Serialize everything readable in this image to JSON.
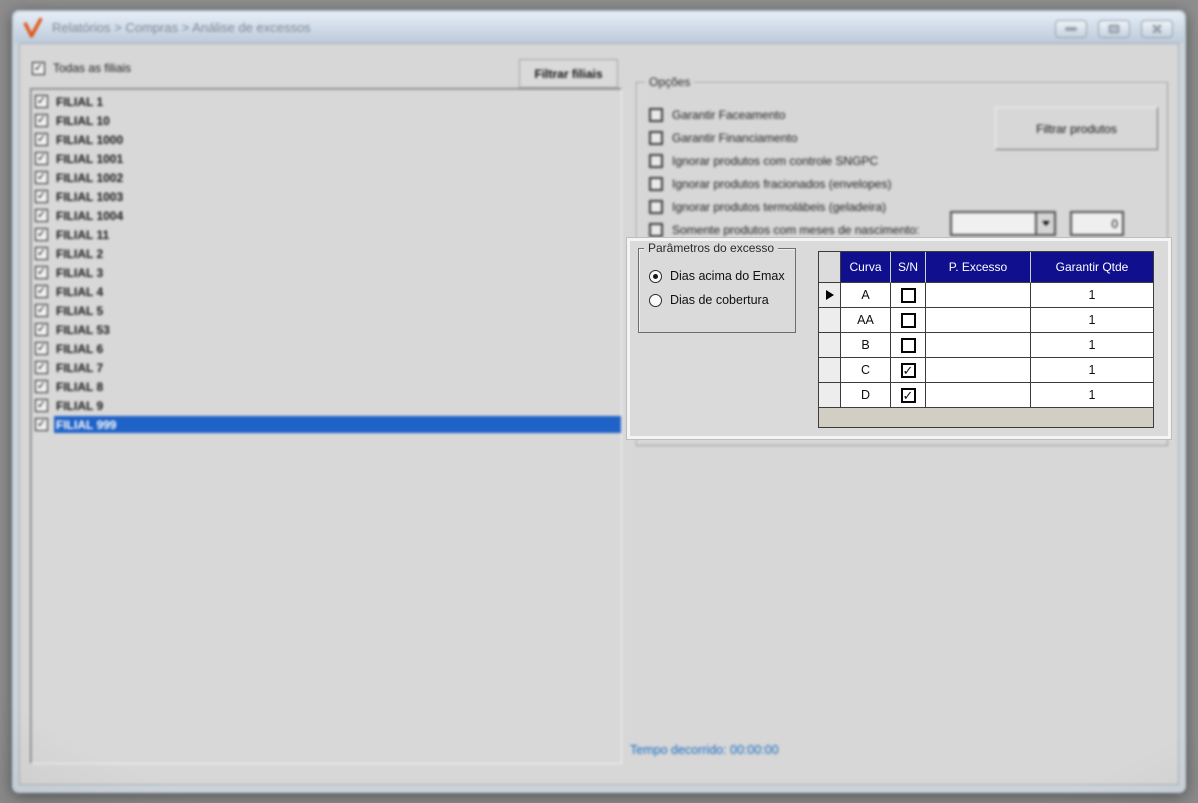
{
  "window": {
    "title": "Relatórios > Compras > Análise de excessos",
    "logo_icon": "v-check-logo"
  },
  "branches": {
    "select_all": {
      "label": "Todas as filiais",
      "checked": true
    },
    "filter_button_label": "Filtrar filiais",
    "items": [
      {
        "label": "FILIAL 1",
        "checked": true,
        "selected": false
      },
      {
        "label": "FILIAL 10",
        "checked": true,
        "selected": false
      },
      {
        "label": "FILIAL 1000",
        "checked": true,
        "selected": false
      },
      {
        "label": "FILIAL 1001",
        "checked": true,
        "selected": false
      },
      {
        "label": "FILIAL 1002",
        "checked": true,
        "selected": false
      },
      {
        "label": "FILIAL 1003",
        "checked": true,
        "selected": false
      },
      {
        "label": "FILIAL 1004",
        "checked": true,
        "selected": false
      },
      {
        "label": "FILIAL 11",
        "checked": true,
        "selected": false
      },
      {
        "label": "FILIAL 2",
        "checked": true,
        "selected": false
      },
      {
        "label": "FILIAL 3",
        "checked": true,
        "selected": false
      },
      {
        "label": "FILIAL 4",
        "checked": true,
        "selected": false
      },
      {
        "label": "FILIAL 5",
        "checked": true,
        "selected": false
      },
      {
        "label": "FILIAL 53",
        "checked": true,
        "selected": false
      },
      {
        "label": "FILIAL 6",
        "checked": true,
        "selected": false
      },
      {
        "label": "FILIAL 7",
        "checked": true,
        "selected": false
      },
      {
        "label": "FILIAL 8",
        "checked": true,
        "selected": false
      },
      {
        "label": "FILIAL 9",
        "checked": true,
        "selected": false
      },
      {
        "label": "FILIAL 999",
        "checked": true,
        "selected": true
      }
    ]
  },
  "options": {
    "group_label": "Opções",
    "filter_products_button_label": "Filtrar produtos",
    "checkboxes": [
      {
        "label": "Garantir Faceamento",
        "checked": false
      },
      {
        "label": "Garantir Financiamento",
        "checked": false
      },
      {
        "label": "Ignorar produtos com controle SNGPC",
        "checked": false
      },
      {
        "label": "Ignorar produtos fracionados (envelopes)",
        "checked": false
      },
      {
        "label": "Ignorar produtos termolábeis (geladeira)",
        "checked": false
      },
      {
        "label": "Somente produtos com meses de nascimento:",
        "checked": false
      }
    ],
    "months_dropdown_value": "",
    "months_value": "0"
  },
  "excess_params": {
    "group_label": "Parâmetros do excesso",
    "radios": [
      {
        "label": "Dias acima do Emax",
        "selected": true
      },
      {
        "label": "Dias de cobertura",
        "selected": false
      }
    ]
  },
  "curve_table": {
    "columns": [
      "Curva",
      "S/N",
      "P. Excesso",
      "Garantir Qtde"
    ],
    "rows": [
      {
        "curva": "A",
        "sn": false,
        "p_excesso": "",
        "garantir_qtde": "1",
        "current": true
      },
      {
        "curva": "AA",
        "sn": false,
        "p_excesso": "",
        "garantir_qtde": "1",
        "current": false
      },
      {
        "curva": "B",
        "sn": false,
        "p_excesso": "",
        "garantir_qtde": "1",
        "current": false
      },
      {
        "curva": "C",
        "sn": true,
        "p_excesso": "",
        "garantir_qtde": "1",
        "current": false
      },
      {
        "curva": "D",
        "sn": true,
        "p_excesso": "",
        "garantir_qtde": "1",
        "current": false
      }
    ]
  },
  "status": {
    "elapsed": "Tempo decorrido: 00:00:00"
  },
  "colors": {
    "selection_blue": "#1f62c8",
    "table_header_navy": "#10108f",
    "logo_orange": "#e2571b",
    "table_footer_beige": "#d3cec4",
    "elapsed_blue": "#1b6cc2"
  }
}
